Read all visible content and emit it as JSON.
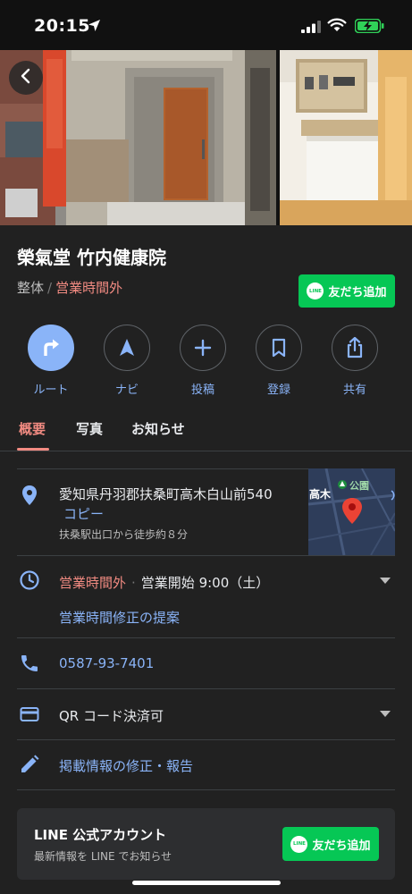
{
  "status_bar": {
    "time": "20:15"
  },
  "place": {
    "name": "榮氣堂 竹内健康院",
    "category": "整体",
    "separator": "/",
    "status": "営業時間外"
  },
  "line_button": {
    "badge": "LINE",
    "label": "友だち追加"
  },
  "actions": [
    {
      "label": "ルート",
      "icon": "directions-icon"
    },
    {
      "label": "ナビ",
      "icon": "navigate-icon"
    },
    {
      "label": "投稿",
      "icon": "plus-icon"
    },
    {
      "label": "登録",
      "icon": "bookmark-icon"
    },
    {
      "label": "共有",
      "icon": "share-icon"
    }
  ],
  "tabs": [
    {
      "label": "概要",
      "active": true
    },
    {
      "label": "写真",
      "active": false
    },
    {
      "label": "お知らせ",
      "active": false
    }
  ],
  "address": {
    "text": "愛知県丹羽郡扶桑町高木白山前540",
    "copy_label": "コピー",
    "walk_info": "扶桑駅出口から徒歩約８分",
    "map_labels": {
      "area": "高木",
      "park": "公園"
    }
  },
  "hours": {
    "status": "営業時間外",
    "separator": "·",
    "next_open": "営業開始 9:00（土）",
    "suggest_edit": "営業時間修正の提案"
  },
  "phone": "0587-93-7401",
  "payment": "QR コード決済可",
  "edit_info": "掲載情報の修正・報告",
  "line_card": {
    "title": "LINE 公式アカウント",
    "subtitle": "最新情報を LINE でお知らせ",
    "button_badge": "LINE",
    "button_label": "友だち追加"
  },
  "colors": {
    "background": "#212121",
    "accent_blue": "#8ab4f8",
    "closed_red": "#f28b82",
    "line_green": "#06c755"
  }
}
